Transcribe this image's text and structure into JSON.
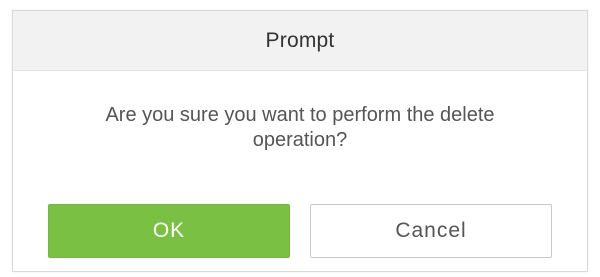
{
  "dialog": {
    "title": "Prompt",
    "message_line1": "Are you sure you want to perform the delete",
    "message_line2": "operation?",
    "ok_label": "OK",
    "cancel_label": "Cancel"
  },
  "colors": {
    "header_bg": "#f2f2f2",
    "ok_bg": "#7ac143",
    "cancel_bg": "#ffffff",
    "text": "#555555"
  }
}
